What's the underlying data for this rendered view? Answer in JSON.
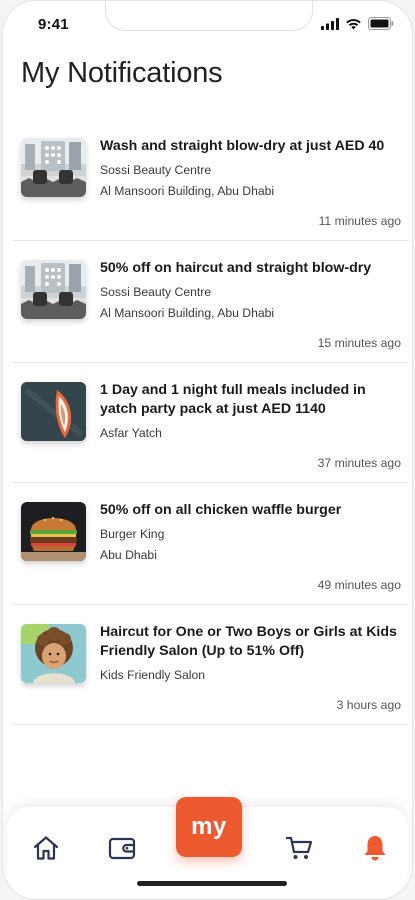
{
  "status_bar": {
    "time": "9:41"
  },
  "header": {
    "title": "My Notifications"
  },
  "notifications": [
    {
      "title": "Wash and straight blow-dry at just AED 40",
      "vendor": "Sossi Beauty Centre",
      "location": "Al Mansoori Building, Abu Dhabi",
      "time": "11 minutes ago",
      "thumbnail": "salon-image"
    },
    {
      "title": "50% off on haircut and straight blow-dry",
      "vendor": "Sossi Beauty Centre",
      "location": "Al Mansoori Building, Abu Dhabi",
      "time": "15 minutes ago",
      "thumbnail": "salon-image"
    },
    {
      "title": "1 Day and 1 night full meals included in yatch party pack at just AED 1140",
      "vendor": "Asfar Yatch",
      "location": "",
      "time": "37 minutes ago",
      "thumbnail": "yacht-image"
    },
    {
      "title": "50% off on all chicken waffle burger",
      "vendor": "Burger King",
      "location": "Abu Dhabi",
      "time": "49 minutes ago",
      "thumbnail": "burger-image"
    },
    {
      "title": "Haircut for One or Two Boys or Girls at Kids Friendly Salon (Up to 51% Off)",
      "vendor": "Kids Friendly Salon",
      "location": "",
      "time": "3 hours ago",
      "thumbnail": "child-image"
    }
  ],
  "bottom_nav": {
    "center_label": "my",
    "items": [
      "home-icon",
      "wallet-icon",
      "cart-icon",
      "bell-icon"
    ],
    "accent_color": "#ee5a30",
    "icon_color": "#2b3550"
  }
}
